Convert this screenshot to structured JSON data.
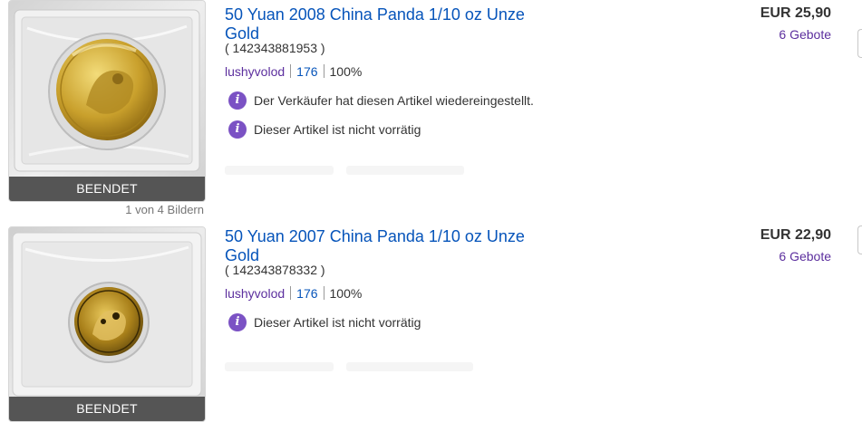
{
  "listings": [
    {
      "title": "50 Yuan 2008 China Panda 1/10 oz Unze Gold",
      "item_id": "( 142343881953 )",
      "seller_name": "lushyvolod",
      "feedback_count": "176",
      "feedback_percent": "100%",
      "price": "EUR 25,90",
      "bids": "6 Gebote",
      "status_banner": "BEENDET",
      "photo_count": "1 von 4 Bildern",
      "notices": [
        "Der Verkäufer hat diesen Artikel wiedereingestellt.",
        "Dieser Artikel ist nicht vorrätig"
      ]
    },
    {
      "title": "50 Yuan 2007 China Panda 1/10 oz Unze Gold",
      "item_id": "( 142343878332 )",
      "seller_name": "lushyvolod",
      "feedback_count": "176",
      "feedback_percent": "100%",
      "price": "EUR 22,90",
      "bids": "6 Gebote",
      "status_banner": "BEENDET",
      "notices": [
        "Dieser Artikel ist nicht vorrätig"
      ]
    }
  ],
  "icons": {
    "notice": "info-icon"
  },
  "colors": {
    "link": "#0654ba",
    "purple": "#5c2f9e",
    "info_badge": "#7b52c4",
    "banner": "#555555"
  }
}
